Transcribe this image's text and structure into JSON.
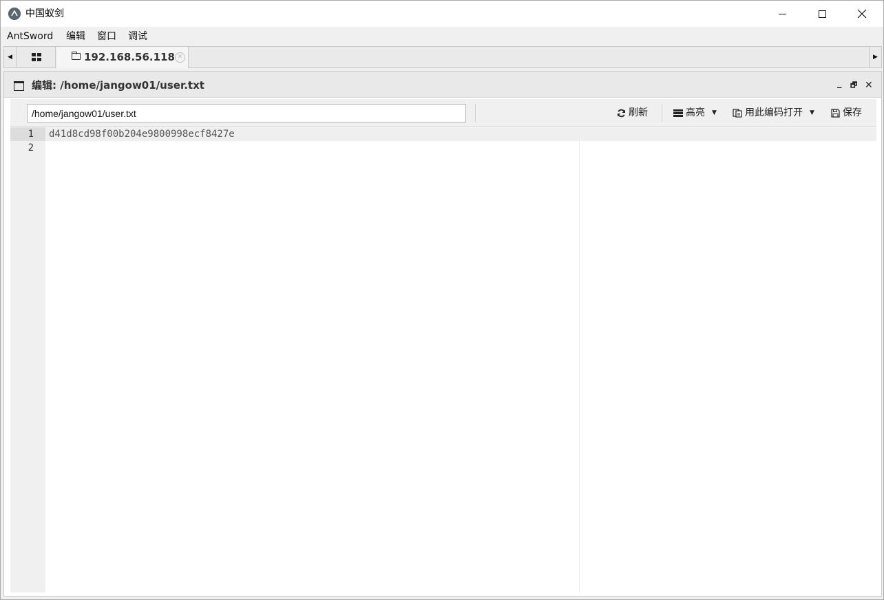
{
  "window": {
    "title": "中国蚁剑",
    "app_icon_glyph": "ꟹ"
  },
  "menu": {
    "items": [
      "AntSword",
      "编辑",
      "窗口",
      "调试"
    ]
  },
  "tabs": {
    "active_label": "192.168.56.118"
  },
  "panel": {
    "title": "编辑: /home/jangow01/user.txt",
    "controls": {
      "minimize": "_",
      "restore": "🗗",
      "close": "✕"
    }
  },
  "toolbar": {
    "path_value": "/home/jangow01/user.txt",
    "refresh_label": "刷新",
    "highlight_label": "高亮",
    "open_with_encoding_label": "用此编码打开",
    "save_label": "保存"
  },
  "editor": {
    "lines": [
      {
        "number": "1",
        "text": "d41d8cd98f00b204e9800998ecf8427e"
      },
      {
        "number": "2",
        "text": ""
      }
    ]
  }
}
